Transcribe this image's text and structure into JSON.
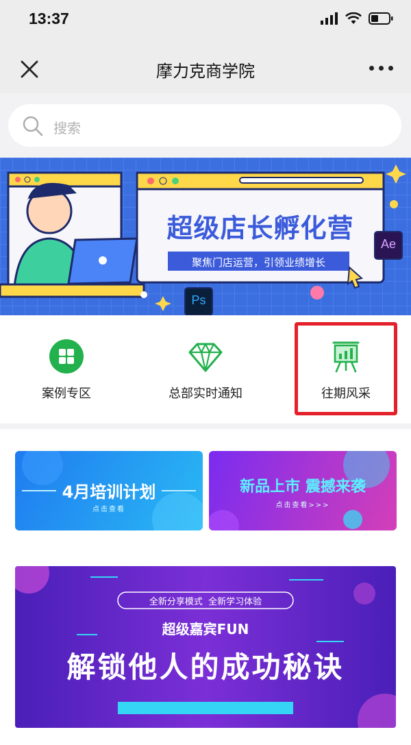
{
  "status": {
    "time": "13:37"
  },
  "nav": {
    "title": "摩力克商学院"
  },
  "search": {
    "placeholder": "搜索"
  },
  "hero": {
    "title": "超级店长孵化营",
    "subtitle": "聚焦门店运营，引领业绩增长",
    "badge_ae": "Ae",
    "badge_ps": "Ps"
  },
  "quick_menu": {
    "items": [
      {
        "label": "案例专区",
        "icon": "grid-icon"
      },
      {
        "label": "总部实时通知",
        "icon": "diamond-icon"
      },
      {
        "label": "往期风采",
        "icon": "presentation-icon"
      }
    ]
  },
  "promos": {
    "left": {
      "title": "4月培训计划",
      "sub": "点击查看"
    },
    "right": {
      "title": "新品上市 震撼来袭",
      "sub": "点击查看>>>"
    }
  },
  "big_banner": {
    "tag": "全新分享模式  全新学习体验",
    "line1": "超级嘉宾FUN",
    "line2": "解锁他人的成功秘诀"
  },
  "colors": {
    "accent_green": "#22b14c",
    "highlight_red": "#e4202a",
    "hero_blue": "#3b6fe0"
  }
}
